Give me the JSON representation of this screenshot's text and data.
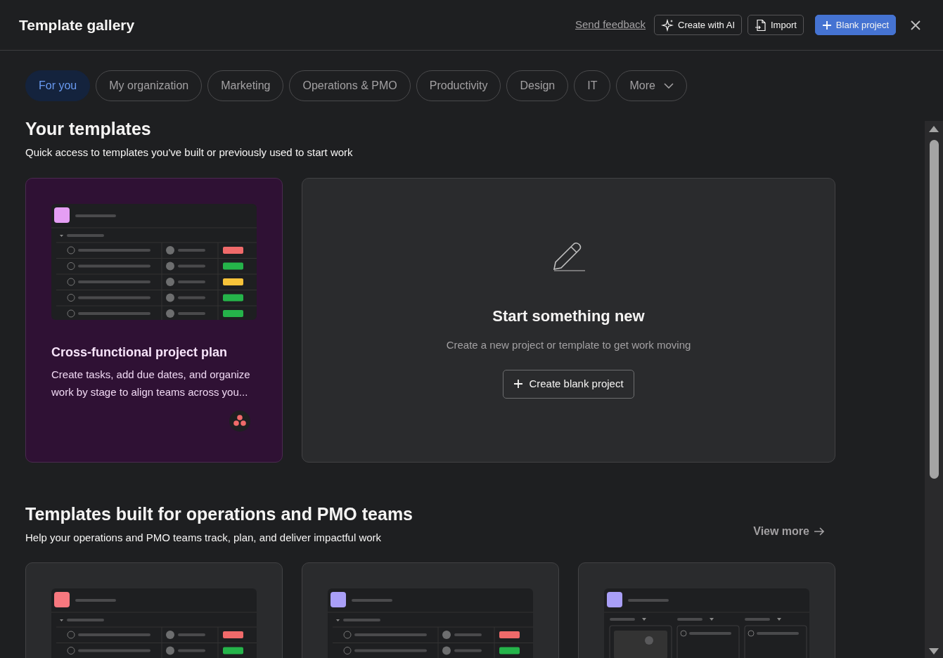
{
  "window": {
    "title": "Template gallery"
  },
  "header_actions": {
    "feedback_link": "Send feedback",
    "create_ai": "Create with AI",
    "import": "Import",
    "blank_project": "Blank project"
  },
  "tabs": [
    {
      "label": "For you",
      "selected": true
    },
    {
      "label": "My organization",
      "selected": false
    },
    {
      "label": "Marketing",
      "selected": false
    },
    {
      "label": "Operations & PMO",
      "selected": false
    },
    {
      "label": "Productivity",
      "selected": false
    },
    {
      "label": "Design",
      "selected": false
    },
    {
      "label": "IT",
      "selected": false
    },
    {
      "label": "More",
      "selected": false,
      "dropdown": true
    }
  ],
  "your_templates": {
    "title": "Your templates",
    "subtitle": "Quick access to templates you've built or previously used to start work",
    "cards": [
      {
        "kind": "list",
        "color": "#e59ef4",
        "title": "Cross-functional project plan",
        "description": "Create tasks, add due dates, and organize work by stage to align teams across you..."
      }
    ],
    "start_new": {
      "title": "Start something new",
      "subtitle": "Create a new project or template to get work moving",
      "button": "Create blank project"
    }
  },
  "ops_section": {
    "title": "Templates built for operations and PMO teams",
    "subtitle": "Help your operations and PMO teams track, plan, and deliver impactful work",
    "view_more": "View more",
    "cards": [
      {
        "kind": "list",
        "color": "#f7787f"
      },
      {
        "kind": "list",
        "color": "#a99ff7"
      },
      {
        "kind": "board",
        "color": "#a99ff7"
      }
    ]
  }
}
